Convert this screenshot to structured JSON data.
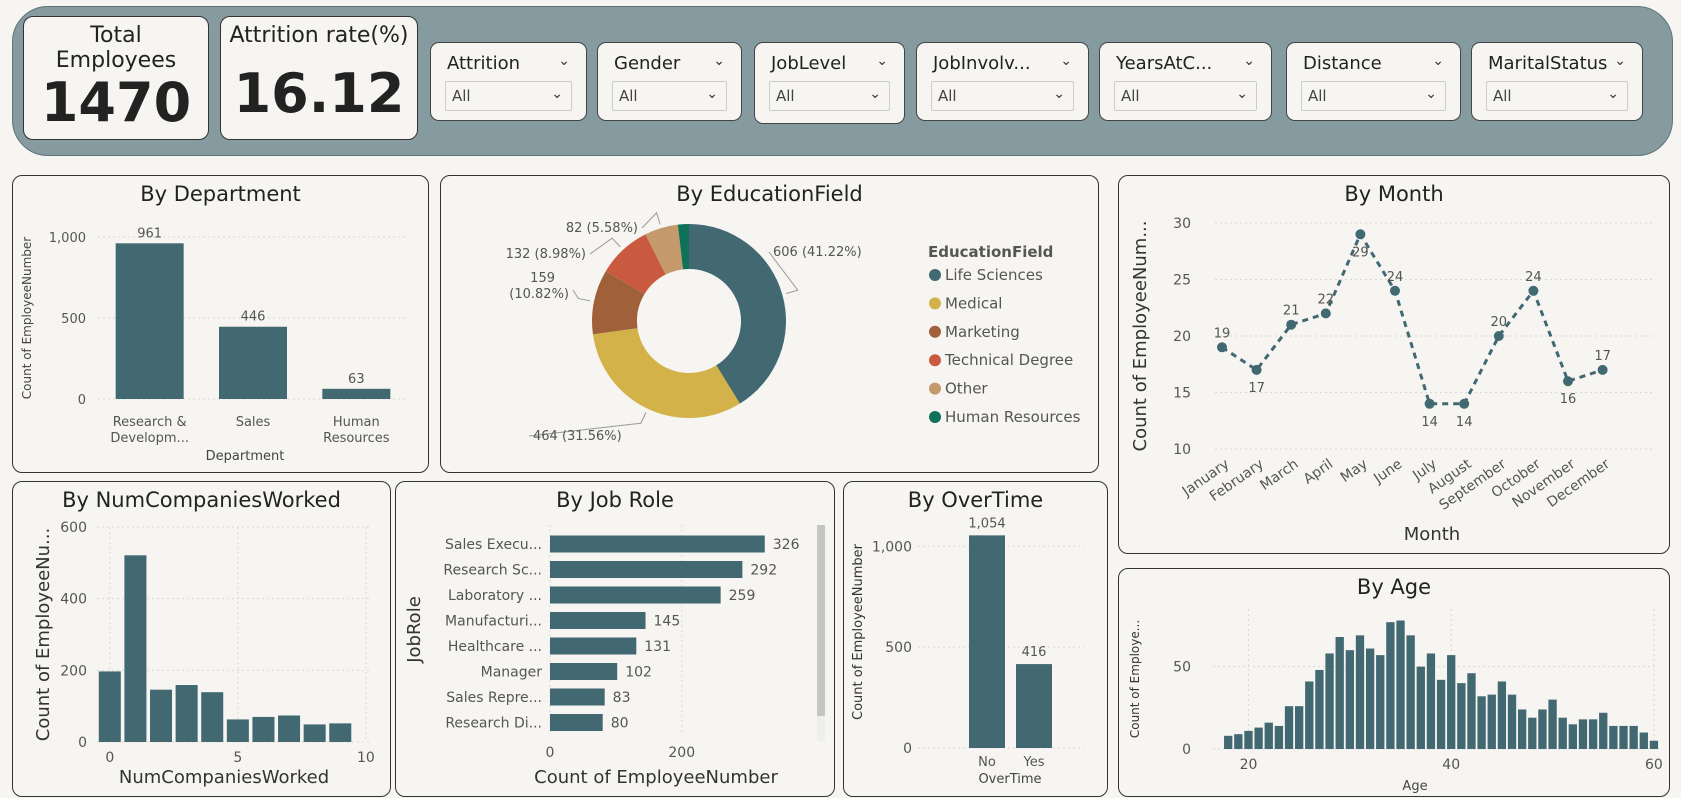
{
  "kpis": {
    "total_employees": {
      "label_line1": "Total",
      "label_line2": "Employees",
      "value": "1470"
    },
    "attrition_rate": {
      "label": "Attrition rate(%)",
      "value": "16.12"
    }
  },
  "slicers": [
    {
      "title": "Attrition",
      "value": "All"
    },
    {
      "title": "Gender",
      "value": "All"
    },
    {
      "title": "JobLevel",
      "value": "All"
    },
    {
      "title": "JobInvolv...",
      "value": "All"
    },
    {
      "title": "YearsAtC...",
      "value": "All"
    },
    {
      "title": "Distance",
      "value": "All"
    },
    {
      "title": "MaritalStatus",
      "value": "All"
    }
  ],
  "colors": {
    "bar": "#426872",
    "topbar": "#869ba0",
    "background": "#f6f5f1"
  },
  "chart_data": [
    {
      "id": "department",
      "type": "bar",
      "title": "By Department",
      "xlabel": "Department",
      "ylabel": "Count of EmployeeNumber",
      "categories": [
        "Research & Developm...",
        "Sales",
        "Human Resources"
      ],
      "category_lines": [
        [
          "Research &",
          "Developm..."
        ],
        [
          "Sales"
        ],
        [
          "Human",
          "Resources"
        ]
      ],
      "values": [
        961,
        446,
        63
      ],
      "ylim": [
        0,
        1000
      ],
      "yticks": [
        0,
        500,
        1000
      ],
      "ytick_labels": [
        "0",
        "500",
        "1,000"
      ],
      "grid": true
    },
    {
      "id": "education",
      "type": "pie",
      "title": "By EducationField",
      "legend_title": "EducationField",
      "categories": [
        "Life Sciences",
        "Medical",
        "Marketing",
        "Technical Degree",
        "Other",
        "Human Resources"
      ],
      "values": [
        606,
        464,
        159,
        132,
        82,
        27
      ],
      "labels": [
        "606 (41.22%)",
        "464 (31.56%)",
        "159 (10.82%)",
        "132 (8.98%)",
        "82 (5.58%)",
        ""
      ],
      "colors": [
        "#426872",
        "#d4b24a",
        "#a0603a",
        "#c9593f",
        "#c4996b",
        "#0f7157"
      ],
      "legend_position": "right"
    },
    {
      "id": "month",
      "type": "line",
      "title": "By Month",
      "xlabel": "Month",
      "ylabel": "Count of EmployeeNum...",
      "categories": [
        "January",
        "February",
        "March",
        "April",
        "May",
        "June",
        "July",
        "August",
        "September",
        "October",
        "November",
        "December"
      ],
      "values": [
        19,
        17,
        21,
        22,
        29,
        24,
        14,
        14,
        20,
        24,
        16,
        17
      ],
      "ylim": [
        10,
        30
      ],
      "yticks": [
        10,
        15,
        20,
        25,
        30
      ],
      "grid": true,
      "line_style": "dashed"
    },
    {
      "id": "numcompanies",
      "type": "bar",
      "title": "By NumCompaniesWorked",
      "xlabel": "NumCompaniesWorked",
      "ylabel": "Count of EmployeeNu...",
      "x": [
        0,
        1,
        2,
        3,
        4,
        5,
        6,
        7,
        8,
        9
      ],
      "values": [
        197,
        521,
        146,
        159,
        139,
        63,
        70,
        74,
        49,
        52
      ],
      "xlim": [
        -0.5,
        10.2
      ],
      "xticks": [
        0,
        5,
        10
      ],
      "ylim": [
        0,
        600
      ],
      "yticks": [
        0,
        200,
        400,
        600
      ],
      "grid": true
    },
    {
      "id": "jobrole",
      "type": "bar",
      "orientation": "horizontal",
      "title": "By Job Role",
      "xlabel": "Count of EmployeeNumber",
      "ylabel": "JobRole",
      "categories": [
        "Sales Execu...",
        "Research Sc...",
        "Laboratory ...",
        "Manufacturi...",
        "Healthcare ...",
        "Manager",
        "Sales Repre...",
        "Research Di..."
      ],
      "values": [
        326,
        292,
        259,
        145,
        131,
        102,
        83,
        80
      ],
      "xlim": [
        0,
        340
      ],
      "xticks": [
        0,
        200
      ],
      "grid": true
    },
    {
      "id": "overtime",
      "type": "bar",
      "title": "By OverTime",
      "xlabel": "OverTime",
      "ylabel": "Count of EmployeeNumber",
      "categories": [
        "No",
        "Yes"
      ],
      "values": [
        1054,
        416
      ],
      "ylim": [
        0,
        1150
      ],
      "yticks": [
        0,
        500,
        1000
      ],
      "ytick_labels": [
        "0",
        "500",
        "1,000"
      ],
      "grid": true
    },
    {
      "id": "age",
      "type": "bar",
      "title": "By Age",
      "xlabel": "Age",
      "ylabel": "Count of Employe...",
      "x": [
        18,
        19,
        20,
        21,
        22,
        23,
        24,
        25,
        26,
        27,
        28,
        29,
        30,
        31,
        32,
        33,
        34,
        35,
        36,
        37,
        38,
        39,
        40,
        41,
        42,
        43,
        44,
        45,
        46,
        47,
        48,
        49,
        50,
        51,
        52,
        53,
        54,
        55,
        56,
        57,
        58,
        59,
        60
      ],
      "values": [
        8,
        9,
        11,
        13,
        16,
        14,
        26,
        26,
        41,
        48,
        58,
        68,
        60,
        69,
        61,
        57,
        77,
        78,
        69,
        50,
        58,
        42,
        57,
        40,
        46,
        32,
        33,
        41,
        33,
        24,
        19,
        24,
        30,
        19,
        15,
        18,
        18,
        22,
        14,
        14,
        14,
        10,
        5
      ],
      "xlim": [
        16.5,
        60.5
      ],
      "xticks": [
        20,
        40,
        60
      ],
      "ylim": [
        0,
        85
      ],
      "yticks": [
        0,
        50
      ],
      "grid": true
    }
  ]
}
